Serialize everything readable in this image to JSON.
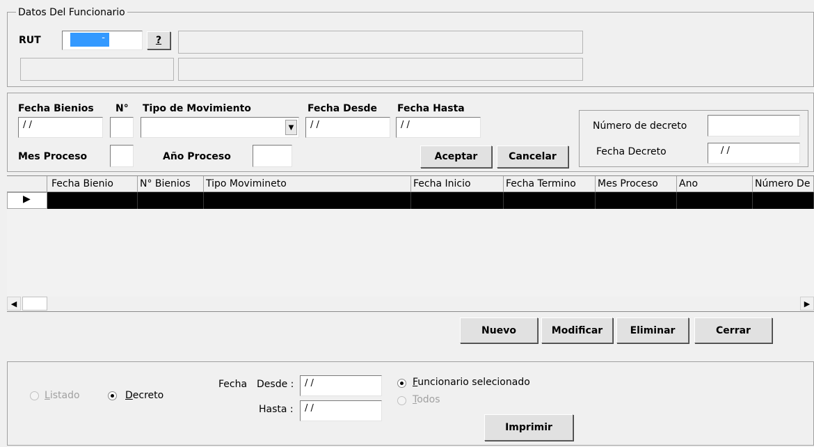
{
  "funcionario": {
    "legend": "Datos Del Funcionario",
    "rut_label": "RUT",
    "rut_value": "-",
    "help_label": "?"
  },
  "movimiento": {
    "fecha_bienios_label": "Fecha Bienios",
    "n_label": "N°",
    "tipo_label": "Tipo de Movimiento",
    "fecha_desde_label": "Fecha Desde",
    "fecha_hasta_label": "Fecha Hasta",
    "fecha_bienios_value": "/ /",
    "fecha_desde_value": "/ /",
    "fecha_hasta_value": "/ /",
    "mes_proceso_label": "Mes Proceso",
    "anio_proceso_label": "Año Proceso",
    "aceptar_label": "Aceptar",
    "cancelar_label": "Cancelar"
  },
  "decreto": {
    "numero_label": "Número de decreto",
    "fecha_label": "Fecha Decreto",
    "fecha_value": "/ /"
  },
  "grid": {
    "columns": [
      "Fecha Bienio",
      "N° Bienios",
      "Tipo Movimineto",
      "Fecha Inicio",
      "Fecha Termino",
      "Mes Proceso",
      "Ano",
      "Número De"
    ],
    "row_indicator": "▶"
  },
  "actions": {
    "nuevo": "Nuevo",
    "modificar": "Modificar",
    "eliminar": "Eliminar",
    "cerrar": "Cerrar"
  },
  "report": {
    "listado_label": "Listado",
    "decreto_label": "Decreto",
    "fecha_label": "Fecha",
    "desde_label": "Desde :",
    "hasta_label": "Hasta :",
    "desde_value": "/ /",
    "hasta_value": "/ /",
    "funcionario_sel_label": "Funcionario selecionado",
    "todos_label": "Todos",
    "imprimir_label": "Imprimir"
  }
}
